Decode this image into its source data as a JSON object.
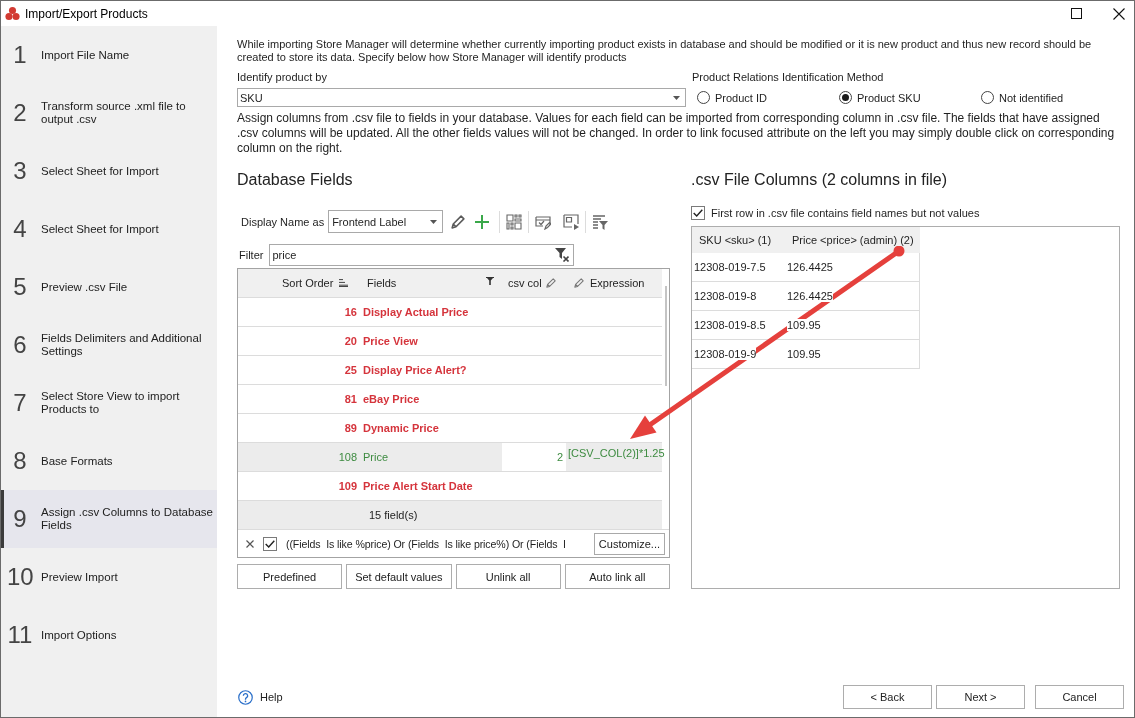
{
  "window": {
    "title": "Import/Export Products"
  },
  "steps": [
    {
      "number": "1",
      "label": "Import File Name",
      "selected": false
    },
    {
      "number": "2",
      "label": "Transform source .xml file to output .csv",
      "selected": false
    },
    {
      "number": "3",
      "label": "Select Sheet for Import",
      "selected": false
    },
    {
      "number": "4",
      "label": "Select Sheet for Import",
      "selected": false
    },
    {
      "number": "5",
      "label": "Preview .csv File",
      "selected": false
    },
    {
      "number": "6",
      "label": "Fields Delimiters and Additional Settings",
      "selected": false
    },
    {
      "number": "7",
      "label": "Select Store View to import Products to",
      "selected": false
    },
    {
      "number": "8",
      "label": "Base Formats",
      "selected": false
    },
    {
      "number": "9",
      "label": "Assign .csv Columns to Database Fields",
      "selected": true
    },
    {
      "number": "10",
      "label": "Preview Import",
      "selected": false
    },
    {
      "number": "11",
      "label": "Import Options",
      "selected": false
    }
  ],
  "intro": "While importing Store Manager will determine whether currently importing product exists in database and should be modified or it is new product and thus new record should be created to store its data. Specify below how Store Manager will identify products",
  "identify": {
    "label": "Identify product by",
    "value": "SKU"
  },
  "relations": {
    "label": "Product Relations Identification Method",
    "options": [
      {
        "label": "Product ID",
        "selected": false
      },
      {
        "label": "Product SKU",
        "selected": true
      },
      {
        "label": "Not identified",
        "selected": false
      }
    ]
  },
  "assign_help": "Assign columns from .csv file to fields in your database. Values for each field can be imported from corresponding column in .csv file. The fields that have assigned .csv columns will be updated. All the other fields values will not be changed. In order to link focused attribute on the left you may simply double click on corresponding column on the right.",
  "database_fields": {
    "title": "Database Fields",
    "display_name": {
      "label": "Display Name as",
      "value": "Frontend Label"
    },
    "filter": {
      "label": "Filter",
      "value": "price"
    },
    "columns": [
      {
        "label": "Sort Order",
        "sorted": true,
        "filtered": false,
        "editable": false
      },
      {
        "label": "Fields",
        "sorted": false,
        "filtered": true,
        "editable": false
      },
      {
        "label": "csv col",
        "sorted": false,
        "filtered": false,
        "editable": true
      },
      {
        "label": "Expression",
        "sorted": false,
        "filtered": false,
        "editable": true
      }
    ],
    "rows": [
      {
        "sort_order": "16",
        "field": "Display Actual Price",
        "linked": false,
        "selected": false
      },
      {
        "sort_order": "20",
        "field": "Price View",
        "linked": false,
        "selected": false
      },
      {
        "sort_order": "25",
        "field": "Display Price Alert?",
        "linked": false,
        "selected": false
      },
      {
        "sort_order": "81",
        "field": "eBay Price",
        "linked": false,
        "selected": false
      },
      {
        "sort_order": "89",
        "field": "Dynamic Price",
        "linked": false,
        "selected": false
      },
      {
        "sort_order": "108",
        "field": "Price",
        "linked": true,
        "selected": true,
        "csv_col": "2",
        "expression": "[CSV_COL(2)]*1.25"
      },
      {
        "sort_order": "109",
        "field": "Price Alert Start Date",
        "linked": false,
        "selected": false
      }
    ],
    "summary": "15 field(s)",
    "filter_bar": {
      "enabled": true,
      "text": "((Fields  Is like %price) Or (Fields  Is like price%) Or (Fields  I",
      "button": "Customize..."
    },
    "buttons": [
      "Predefined",
      "Set default values",
      "Unlink all",
      "Auto link all"
    ]
  },
  "csv_file": {
    "title": ".csv File Columns (2 columns in file)",
    "header_row": {
      "label": "First row in .csv file contains field names but not values",
      "checked": true
    },
    "columns": [
      "SKU <sku> (1)",
      "Price <price> (admin) (2)"
    ],
    "rows": [
      [
        "12308-019-7.5",
        "126.4425"
      ],
      [
        "12308-019-8",
        "126.4425"
      ],
      [
        "12308-019-8.5",
        "109.95"
      ],
      [
        "12308-019-9",
        "109.95"
      ]
    ]
  },
  "footer": {
    "help": "Help",
    "buttons": [
      "< Back",
      "Next >",
      "Cancel"
    ]
  }
}
